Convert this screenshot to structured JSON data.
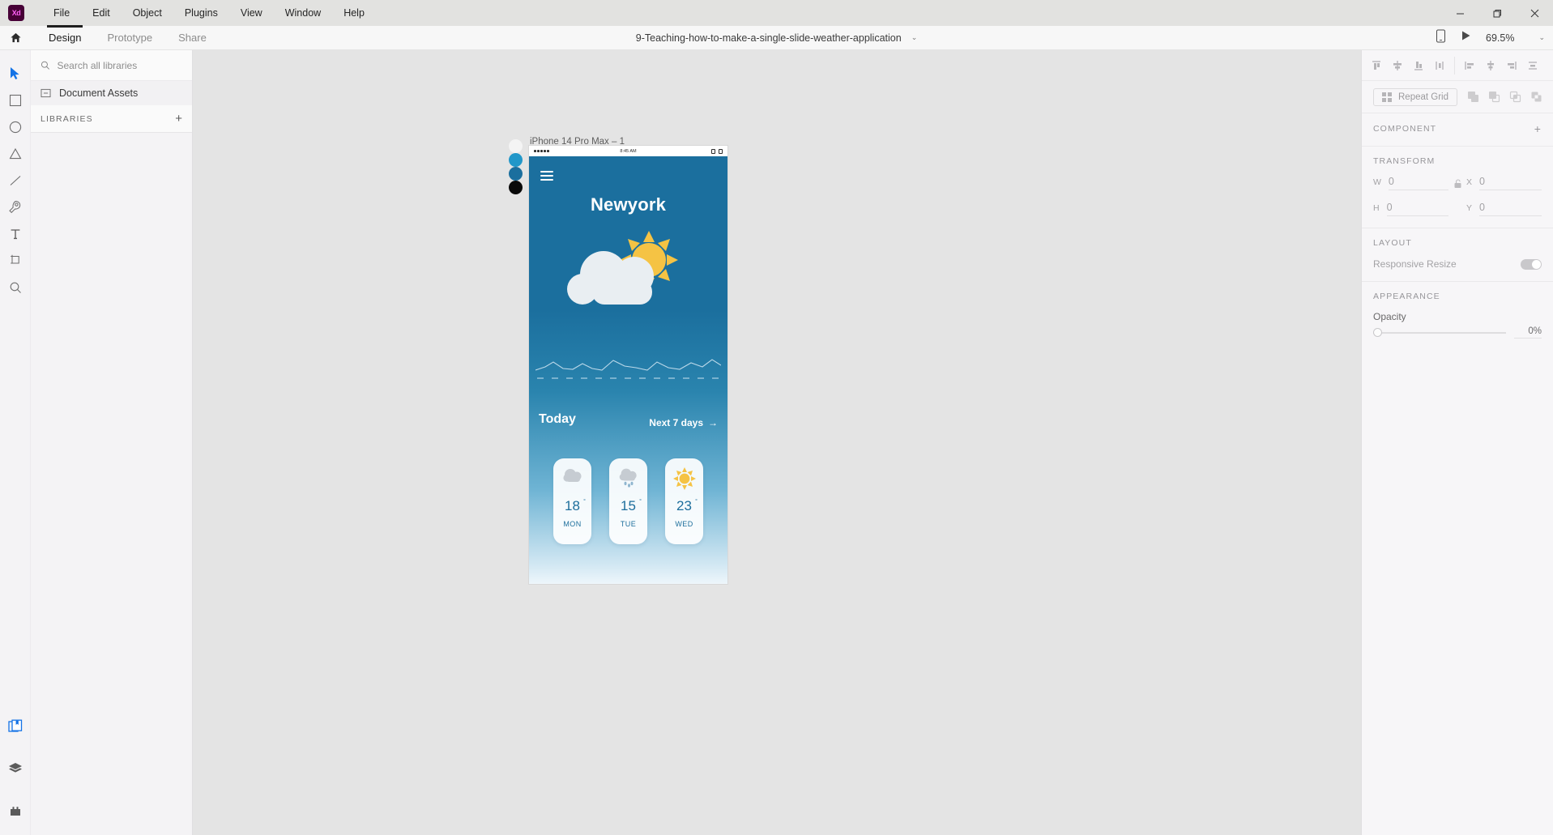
{
  "titlebar": {
    "logo": "Xd",
    "menu": [
      "File",
      "Edit",
      "Object",
      "Plugins",
      "View",
      "Window",
      "Help"
    ],
    "window_controls": {
      "minimize": "–",
      "maximize": "❐",
      "close": "✕"
    }
  },
  "docbar": {
    "home_icon": "home-icon",
    "tabs": [
      {
        "label": "Design",
        "active": true
      },
      {
        "label": "Prototype",
        "active": false
      },
      {
        "label": "Share",
        "active": false
      }
    ],
    "document_title": "9-Teaching-how-to-make-a-single-slide-weather-application",
    "title_caret": "⌄",
    "preview_device_icon": "mobile-preview-icon",
    "play_icon": "▶",
    "zoom_level": "69.5%",
    "zoom_caret": "⌄"
  },
  "toolbar": {
    "tools": [
      {
        "name": "select-tool",
        "active": true
      },
      {
        "name": "rectangle-tool",
        "active": false
      },
      {
        "name": "ellipse-tool",
        "active": false
      },
      {
        "name": "polygon-tool",
        "active": false
      },
      {
        "name": "line-tool",
        "active": false
      },
      {
        "name": "pen-tool",
        "active": false
      },
      {
        "name": "text-tool",
        "active": false
      },
      {
        "name": "artboard-tool",
        "active": false
      },
      {
        "name": "zoom-tool",
        "active": false
      }
    ],
    "bottom": [
      {
        "name": "libraries-panel-button",
        "active": true
      },
      {
        "name": "layers-panel-button",
        "active": false
      },
      {
        "name": "plugins-panel-button",
        "active": false
      }
    ]
  },
  "libraries_panel": {
    "search_placeholder": "Search all libraries",
    "search_value": "",
    "document_assets_label": "Document Assets",
    "libraries_header": "LIBRARIES",
    "add_label": "+"
  },
  "canvas": {
    "artboard_name": "iPhone 14 Pro Max – 1",
    "swatches": [
      "#f4f4f4",
      "#2197c9",
      "#1b6f9e",
      "#0a0a0a"
    ]
  },
  "weather_app": {
    "status_bar": {
      "signal_dots": 5,
      "time": "8:45 AM"
    },
    "menu_icon": "hamburger-menu-icon",
    "city": "Newyork",
    "hero_icon": "sun-behind-cloud-icon",
    "today_label": "Today",
    "next_days_label": "Next 7 days",
    "next_days_arrow": "→",
    "forecast": [
      {
        "icon": "cloud-icon",
        "temp": "18",
        "degree": "°",
        "day": "MON"
      },
      {
        "icon": "rain-cloud-icon",
        "temp": "15",
        "degree": "°",
        "day": "TUE"
      },
      {
        "icon": "sun-icon",
        "temp": "23",
        "degree": "°",
        "day": "WED"
      }
    ]
  },
  "right_panel": {
    "align_icons": [
      "align-top-icon",
      "align-vertical-center-icon",
      "align-bottom-icon",
      "distribute-vertical-icon",
      "align-left-icon",
      "align-horizontal-center-icon",
      "align-right-icon",
      "distribute-horizontal-icon"
    ],
    "repeat_grid_label": "Repeat Grid",
    "boolean_icons": [
      "add-shape-icon",
      "subtract-shape-icon",
      "intersect-shape-icon",
      "exclude-overlap-icon"
    ],
    "component": {
      "header": "COMPONENT",
      "add": "+"
    },
    "transform": {
      "header": "TRANSFORM",
      "w_label": "W",
      "w_value": "0",
      "h_label": "H",
      "h_value": "0",
      "x_label": "X",
      "x_value": "0",
      "y_label": "Y",
      "y_value": "0",
      "lock_icon": "unlocked-aspect-ratio-icon"
    },
    "layout": {
      "header": "LAYOUT",
      "responsive_resize_label": "Responsive Resize",
      "responsive_resize_on": true
    },
    "appearance": {
      "header": "APPEARANCE",
      "opacity_label": "Opacity",
      "opacity_value": "0%"
    }
  }
}
